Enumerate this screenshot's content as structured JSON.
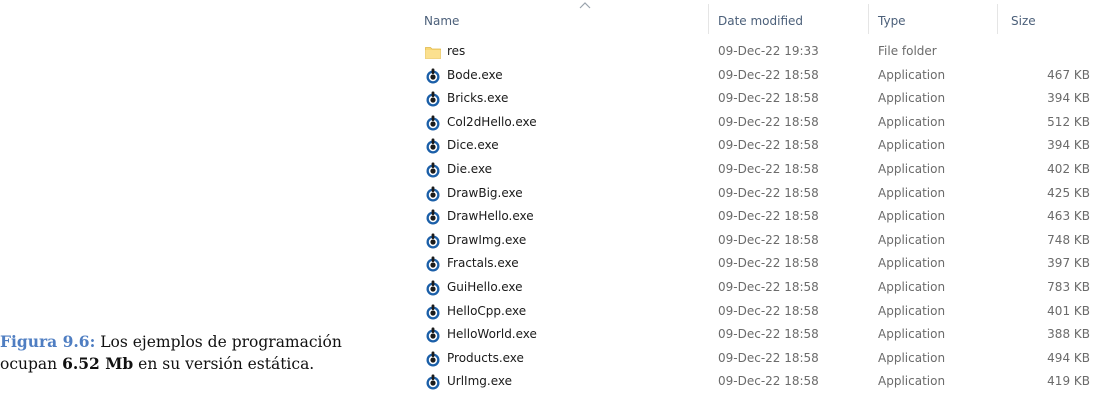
{
  "caption": {
    "label": "Figura 9.6:",
    "text_before": " Los ejemplos de programación ocupan ",
    "bold_value": "6.52 Mb",
    "text_after": " en su versión estática."
  },
  "columns": {
    "name": "Name",
    "date": "Date modified",
    "type": "Type",
    "size": "Size"
  },
  "colors": {
    "header_text": "#4c607a",
    "folder": "#f8d775",
    "app_icon_blue": "#1b5fa8",
    "app_icon_dark": "#1b1b1b"
  },
  "files": [
    {
      "name": "res",
      "date": "09-Dec-22 19:33",
      "type": "File folder",
      "size": "",
      "icon": "folder-icon"
    },
    {
      "name": "Bode.exe",
      "date": "09-Dec-22 18:58",
      "type": "Application",
      "size": "467 KB",
      "icon": "application-icon"
    },
    {
      "name": "Bricks.exe",
      "date": "09-Dec-22 18:58",
      "type": "Application",
      "size": "394 KB",
      "icon": "application-icon"
    },
    {
      "name": "Col2dHello.exe",
      "date": "09-Dec-22 18:58",
      "type": "Application",
      "size": "512 KB",
      "icon": "application-icon"
    },
    {
      "name": "Dice.exe",
      "date": "09-Dec-22 18:58",
      "type": "Application",
      "size": "394 KB",
      "icon": "application-icon"
    },
    {
      "name": "Die.exe",
      "date": "09-Dec-22 18:58",
      "type": "Application",
      "size": "402 KB",
      "icon": "application-icon"
    },
    {
      "name": "DrawBig.exe",
      "date": "09-Dec-22 18:58",
      "type": "Application",
      "size": "425 KB",
      "icon": "application-icon"
    },
    {
      "name": "DrawHello.exe",
      "date": "09-Dec-22 18:58",
      "type": "Application",
      "size": "463 KB",
      "icon": "application-icon"
    },
    {
      "name": "DrawImg.exe",
      "date": "09-Dec-22 18:58",
      "type": "Application",
      "size": "748 KB",
      "icon": "application-icon"
    },
    {
      "name": "Fractals.exe",
      "date": "09-Dec-22 18:58",
      "type": "Application",
      "size": "397 KB",
      "icon": "application-icon"
    },
    {
      "name": "GuiHello.exe",
      "date": "09-Dec-22 18:58",
      "type": "Application",
      "size": "783 KB",
      "icon": "application-icon"
    },
    {
      "name": "HelloCpp.exe",
      "date": "09-Dec-22 18:58",
      "type": "Application",
      "size": "401 KB",
      "icon": "application-icon"
    },
    {
      "name": "HelloWorld.exe",
      "date": "09-Dec-22 18:58",
      "type": "Application",
      "size": "388 KB",
      "icon": "application-icon"
    },
    {
      "name": "Products.exe",
      "date": "09-Dec-22 18:58",
      "type": "Application",
      "size": "494 KB",
      "icon": "application-icon"
    },
    {
      "name": "UrlImg.exe",
      "date": "09-Dec-22 18:58",
      "type": "Application",
      "size": "419 KB",
      "icon": "application-icon"
    }
  ]
}
